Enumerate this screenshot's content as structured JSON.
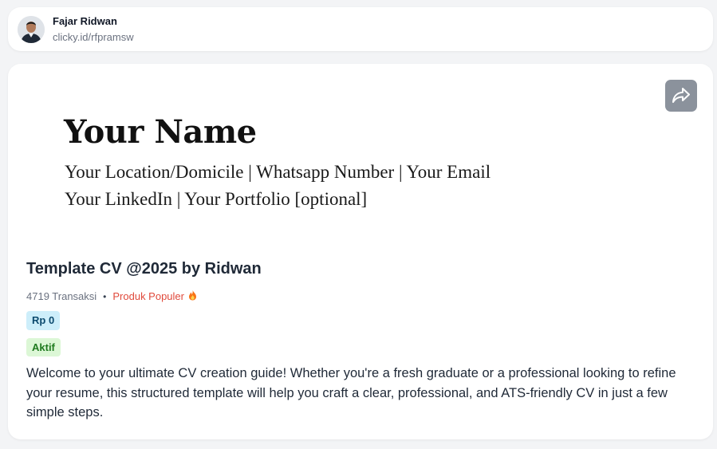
{
  "profile": {
    "name": "Fajar Ridwan",
    "link": "clicky.id/rfpramsw",
    "avatar_icon": "person-avatar"
  },
  "product": {
    "share_icon": "share-icon",
    "preview": {
      "name": "Your Name",
      "line1": "Your Location/Domicile | Whatsapp Number | Your Email",
      "line2": "Your LinkedIn | Your Portfolio [optional]"
    },
    "title": "Template CV @2025 by Ridwan",
    "transactions": "4719 Transaksi",
    "separator": "•",
    "popular_label": "Produk Populer",
    "fire_icon": "fire-icon",
    "price": "Rp 0",
    "status": "Aktif",
    "description": "Welcome to your ultimate CV creation guide! Whether you're a fresh graduate or a professional looking to refine your resume, this structured template will help you craft a clear, professional, and ATS-friendly CV in just a few simple steps."
  },
  "colors": {
    "popular": "#e04a3c",
    "price_badge_bg": "#cdeefa",
    "status_badge_bg": "#dcf7d6",
    "share_button_bg": "#8b929c"
  }
}
